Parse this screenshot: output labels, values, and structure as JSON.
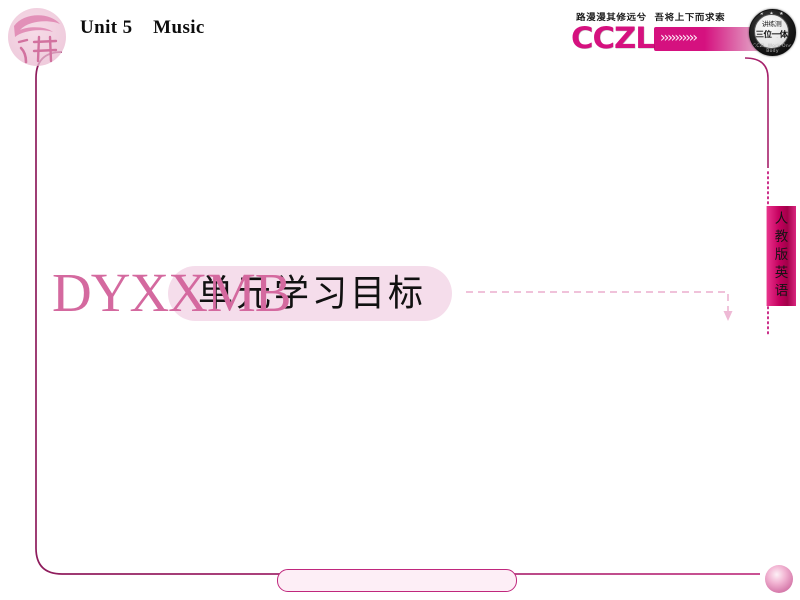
{
  "page": {
    "background_color": "#ffffff",
    "accent_pink": "#d5117f",
    "accent_light_pink": "#f5ddeb",
    "frame_color": "#a6216b",
    "heading_pink": "#d4699f"
  },
  "header": {
    "logo_icon": "brush-character-jiang-icon",
    "logo_char": "讲",
    "title": "Unit 5    Music"
  },
  "brand": {
    "motto": "路漫漫其修远兮  吾将上下而求索",
    "name": "CCZL",
    "band_icon": "chevron-arrows-icon",
    "band_chevrons": "››››››››››",
    "seal": {
      "stars": "★ ★ ★",
      "line1": "讲练测",
      "line2": "三位一体",
      "dots": "· · ·",
      "arc_text": "CCZL  Work  One  Body"
    }
  },
  "main": {
    "heading_code": "DYXXMB",
    "heading_label": "单元学习目标",
    "connector_icon": "dashed-arrow-down-icon"
  },
  "side_tab": {
    "chars": [
      "人",
      "教",
      "版",
      "英",
      "语"
    ],
    "text": "人教版英语"
  },
  "footer": {
    "pill_label": "",
    "knob_icon": "circle-knob-icon"
  }
}
